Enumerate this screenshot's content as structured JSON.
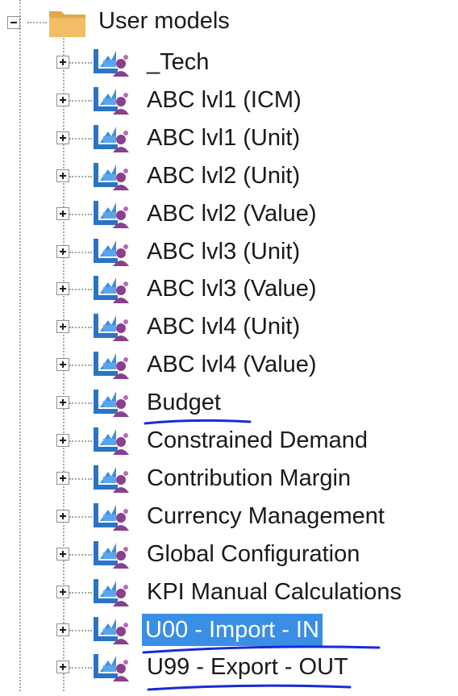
{
  "tree": {
    "root": {
      "label": "User models",
      "expanded": true,
      "icon": "folder-icon",
      "folder_color": "#e9b359"
    },
    "item_icon": "model-cube-user-icon",
    "selection_color": "#3a8ee6",
    "annotation_color": "#1a2ad8",
    "items": [
      {
        "label": "_Tech",
        "selected": false
      },
      {
        "label": "ABC lvl1 (ICM)",
        "selected": false
      },
      {
        "label": "ABC lvl1 (Unit)",
        "selected": false
      },
      {
        "label": "ABC lvl2 (Unit)",
        "selected": false
      },
      {
        "label": "ABC lvl2 (Value)",
        "selected": false
      },
      {
        "label": "ABC lvl3 (Unit)",
        "selected": false
      },
      {
        "label": "ABC lvl3 (Value)",
        "selected": false
      },
      {
        "label": "ABC lvl4 (Unit)",
        "selected": false
      },
      {
        "label": "ABC lvl4 (Value)",
        "selected": false
      },
      {
        "label": "Budget",
        "selected": false,
        "annotated": true
      },
      {
        "label": "Constrained Demand",
        "selected": false
      },
      {
        "label": "Contribution Margin",
        "selected": false
      },
      {
        "label": "Currency Management",
        "selected": false
      },
      {
        "label": "Global Configuration",
        "selected": false
      },
      {
        "label": "KPI Manual Calculations",
        "selected": false
      },
      {
        "label": "U00 - Import - IN",
        "selected": true,
        "annotated": true
      },
      {
        "label": "U99 - Export - OUT",
        "selected": false,
        "annotated": true
      }
    ]
  }
}
